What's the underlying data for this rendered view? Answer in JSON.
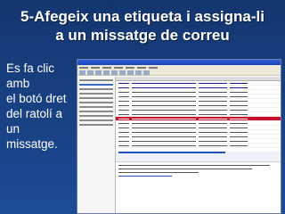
{
  "slide": {
    "title": "5-Afegeix una etiqueta i assigna-li\na un missatge de correu",
    "bullet": "Es fa clic amb\nel botó dret\ndel ratolí a\nun\nmissatge."
  },
  "screenshot": {
    "description_icon": "email-client-screenshot",
    "highlight_color": "#c8102e"
  }
}
